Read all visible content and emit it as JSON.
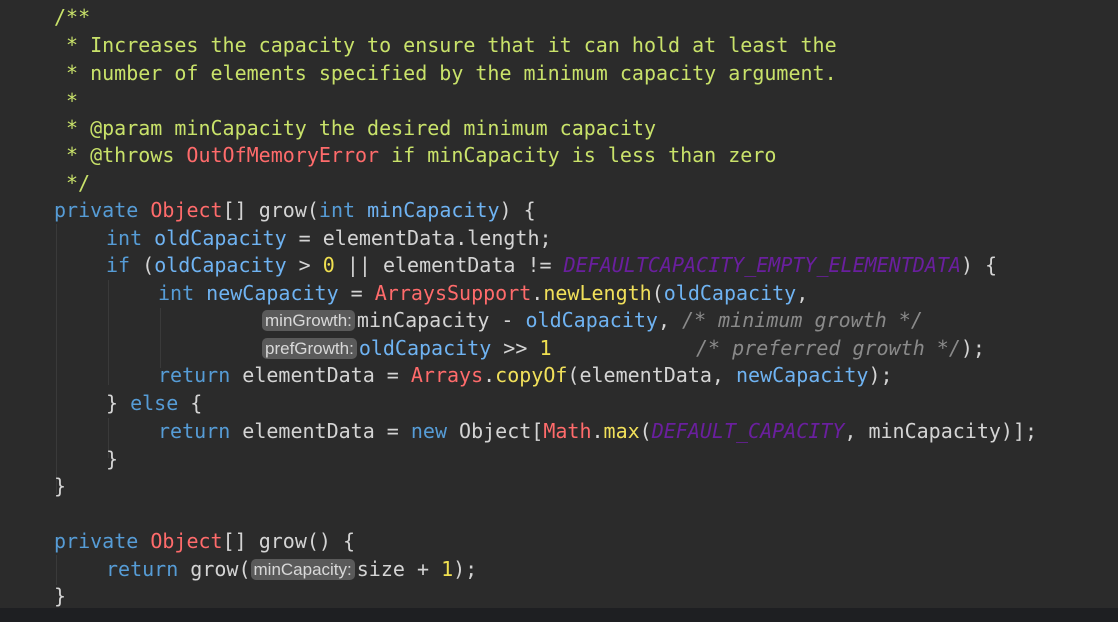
{
  "editor": {
    "language": "java",
    "colors": {
      "background": "#2b2b2b",
      "keyword": "#569cd6",
      "doc_comment": "#c9e26a",
      "type": "#ff6b6b",
      "constant": "#6a1f9e",
      "number": "#f0e050",
      "comment": "#8a8a8a",
      "inlay_hint_bg": "#5a5a5a"
    },
    "lines": [
      [
        "/**"
      ],
      [
        "* Increases the capacity to ensure that it can hold at least the"
      ],
      [
        "* number of elements specified by the minimum capacity argument."
      ],
      [
        "*"
      ],
      [
        "* @param minCapacity the desired minimum capacity"
      ],
      [
        "* @throws ",
        "OutOfMemoryError",
        " if minCapacity is less than zero"
      ],
      [
        "*/"
      ],
      [
        "private",
        " ",
        "Object",
        "[] grow(",
        "int",
        " ",
        "minCapacity",
        ") {"
      ],
      [
        "int",
        " ",
        "oldCapacity",
        " = elementData.length;"
      ],
      [
        "if",
        " (",
        "oldCapacity",
        " > ",
        "0",
        " || elementData != ",
        "DEFAULTCAPACITY_EMPTY_ELEMENTDATA",
        ") {"
      ],
      [
        "int",
        " ",
        "newCapacity",
        " = ",
        "ArraysSupport",
        ".",
        "newLength",
        "(",
        "oldCapacity",
        ","
      ],
      [
        "minGrowth:",
        "minCapacity",
        " - ",
        "oldCapacity",
        ", ",
        "/* minimum growth */"
      ],
      [
        "prefGrowth:",
        "oldCapacity",
        " >> ",
        "1",
        "            ",
        "/* preferred growth */",
        ");"
      ],
      [
        "return",
        " elementData = ",
        "Arrays",
        ".",
        "copyOf",
        "(elementData, ",
        "newCapacity",
        ");"
      ],
      [
        "} ",
        "else",
        " {"
      ],
      [
        "return",
        " elementData = ",
        "new",
        " Object[",
        "Math",
        ".",
        "max",
        "(",
        "DEFAULT_CAPACITY",
        ", ",
        "minCapacity",
        ")];"
      ],
      [
        "}"
      ],
      [
        "}"
      ],
      [
        ""
      ],
      [
        "private",
        " ",
        "Object",
        "[] grow() {"
      ],
      [
        "return",
        " grow(",
        "minCapacity:",
        "size + ",
        "1",
        ");"
      ],
      [
        "}"
      ]
    ]
  }
}
